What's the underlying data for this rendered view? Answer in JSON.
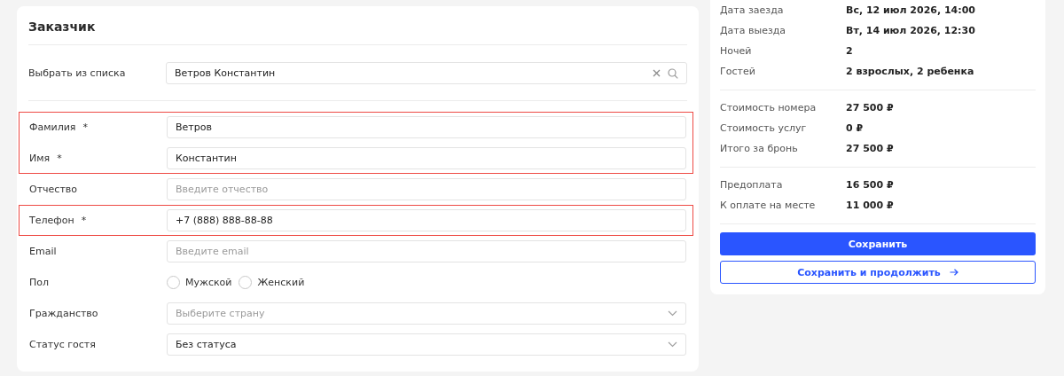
{
  "customer": {
    "title": "Заказчик",
    "lookup": {
      "label": "Выбрать из списка",
      "value": "Ветров Константин"
    },
    "groups": [
      {
        "highlighted": true,
        "rows": [
          {
            "kind": "text",
            "label": "Фамилия",
            "required_mark": "*",
            "value": "Ветров"
          },
          {
            "kind": "text",
            "label": "Имя",
            "required_mark": "*",
            "value": "Константин"
          }
        ]
      },
      {
        "highlighted": false,
        "rows": [
          {
            "kind": "text",
            "label": "Отчество",
            "placeholder": "Введите отчество"
          }
        ]
      },
      {
        "highlighted": true,
        "rows": [
          {
            "kind": "text",
            "label": "Телефон",
            "required_mark": "*",
            "value": "+7 (888) 888-88-88"
          }
        ]
      },
      {
        "highlighted": false,
        "rows": [
          {
            "kind": "text",
            "label": "Email",
            "placeholder": "Введите email"
          },
          {
            "kind": "radio",
            "label": "Пол",
            "options": [
              {
                "label": "Мужской",
                "selected": false
              },
              {
                "label": "Женский",
                "selected": false
              }
            ]
          },
          {
            "kind": "select",
            "label": "Гражданство",
            "placeholder": "Выберите страну"
          },
          {
            "kind": "select",
            "label": "Статус гостя",
            "value": "Без статуса"
          }
        ]
      }
    ]
  },
  "summary": {
    "sections": [
      [
        {
          "label": "Дата заезда",
          "value": "Вс, 12 июл 2026, 14:00"
        },
        {
          "label": "Дата выезда",
          "value": "Вт, 14 июл 2026, 12:30"
        },
        {
          "label": "Ночей",
          "value": "2"
        },
        {
          "label": "Гостей",
          "value": "2 взрослых, 2 ребенка"
        }
      ],
      [
        {
          "label": "Стоимость номера",
          "value": "27 500 ₽"
        },
        {
          "label": "Стоимость услуг",
          "value": "0 ₽"
        },
        {
          "label": "Итого за бронь",
          "value": "27 500 ₽"
        }
      ],
      [
        {
          "label": "Предоплата",
          "value": "16 500 ₽"
        },
        {
          "label": "К оплате на месте",
          "value": "11 000 ₽"
        }
      ]
    ],
    "buttons": [
      {
        "kind": "primary",
        "label": "Сохранить"
      },
      {
        "kind": "secondary",
        "label": "Сохранить и продолжить"
      }
    ]
  }
}
